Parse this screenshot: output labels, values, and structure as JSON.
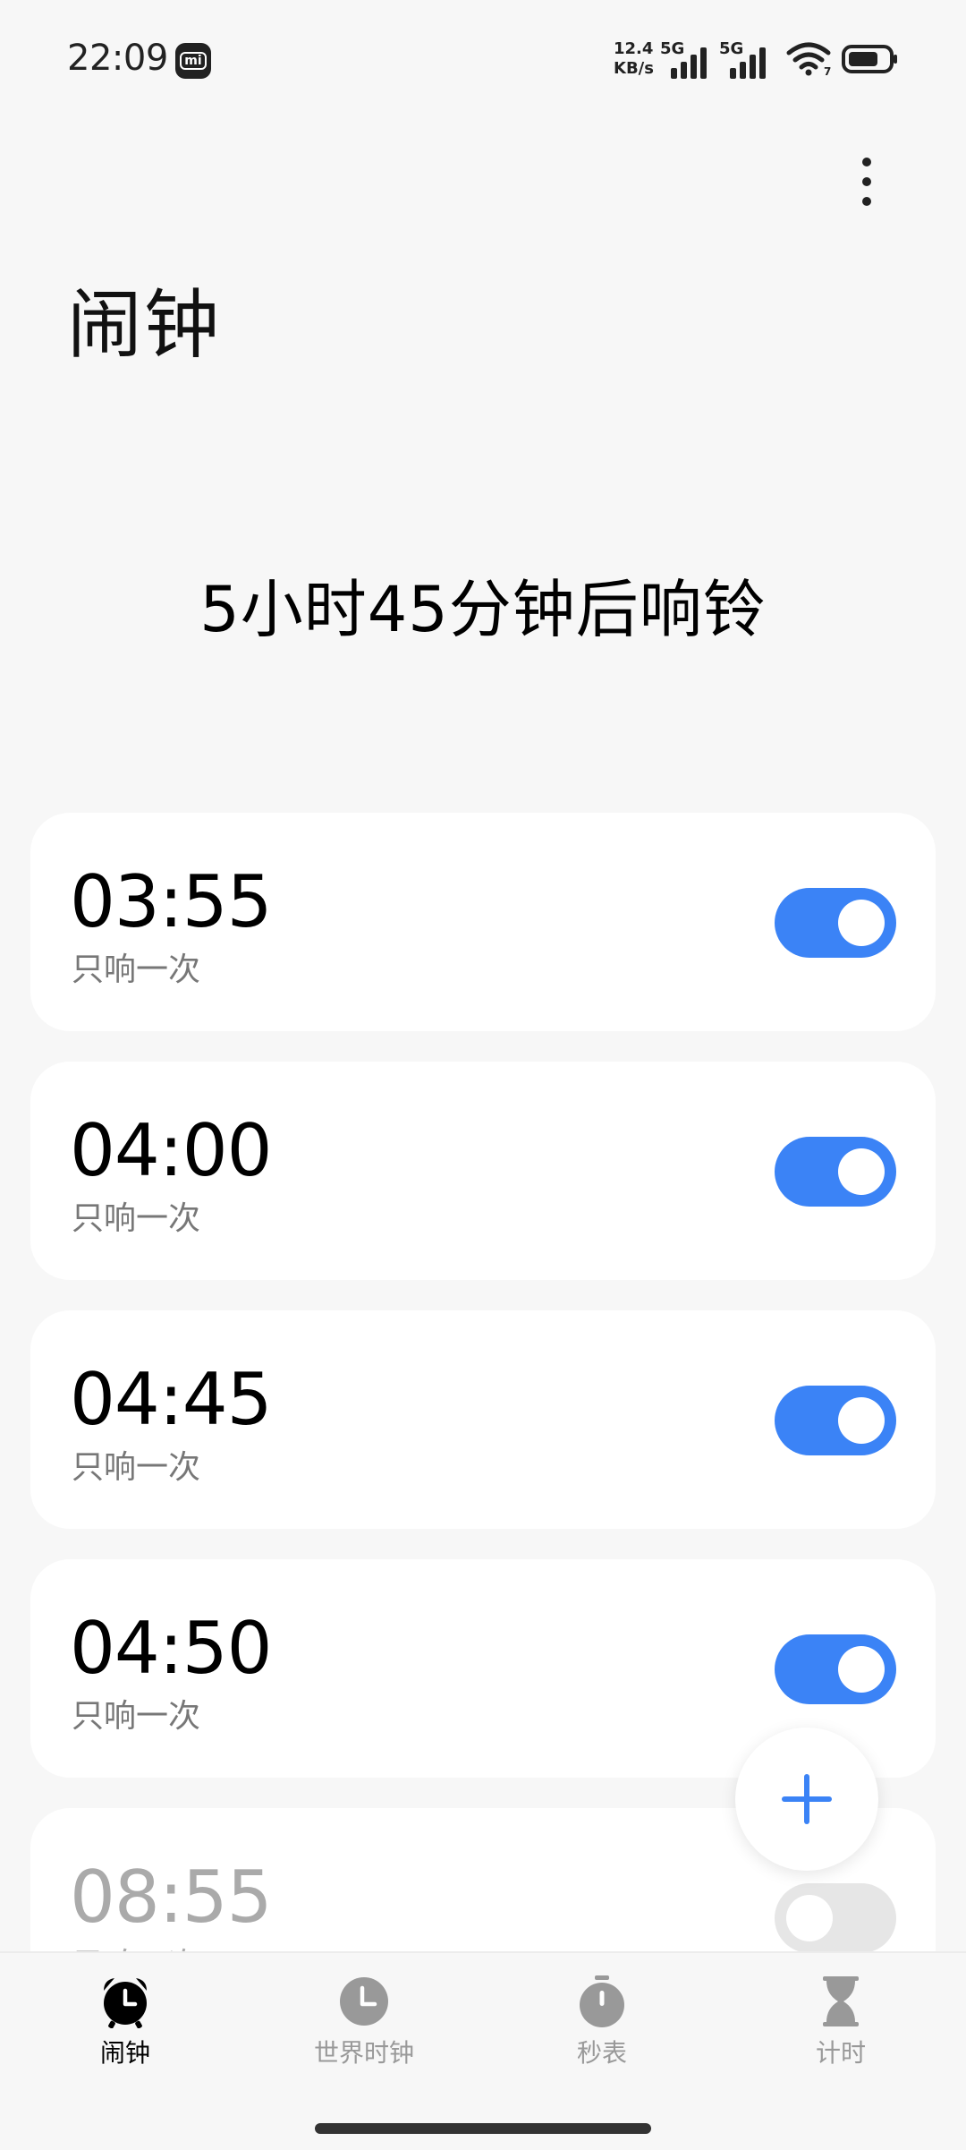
{
  "status_bar": {
    "time": "22:09",
    "mi_badge": "mi",
    "net_speed_value": "12.4",
    "net_speed_unit": "KB/s",
    "sim1_label": "5G",
    "sim2_label": "5G",
    "wifi_badge": "7",
    "battery_level_percent": 75
  },
  "header": {
    "title": "闹钟",
    "menu_icon": "more-vertical-icon"
  },
  "next_alarm_text": "5小时45分钟后响铃",
  "alarms": [
    {
      "time": "03:55",
      "repeat": "只响一次",
      "enabled": true
    },
    {
      "time": "04:00",
      "repeat": "只响一次",
      "enabled": true
    },
    {
      "time": "04:45",
      "repeat": "只响一次",
      "enabled": true
    },
    {
      "time": "04:50",
      "repeat": "只响一次",
      "enabled": true
    },
    {
      "time": "08:55",
      "repeat": "只响一次",
      "enabled": false
    }
  ],
  "fab": {
    "icon": "plus-icon"
  },
  "bottom_nav": {
    "items": [
      {
        "label": "闹钟",
        "icon": "alarm-clock-icon",
        "active": true
      },
      {
        "label": "世界时钟",
        "icon": "world-clock-icon",
        "active": false
      },
      {
        "label": "秒表",
        "icon": "stopwatch-icon",
        "active": false
      },
      {
        "label": "计时",
        "icon": "hourglass-icon",
        "active": false
      }
    ]
  },
  "colors": {
    "accent": "#3b83f6",
    "background": "#f7f7f7",
    "card": "#ffffff"
  }
}
